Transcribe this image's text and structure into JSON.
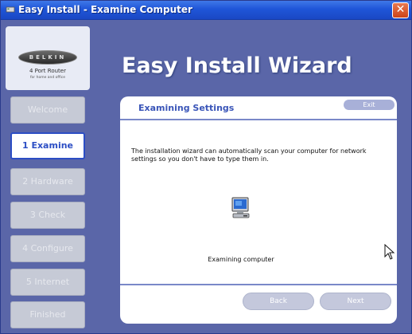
{
  "window": {
    "title": "Easy Install - Examine Computer",
    "close_glyph": "✕"
  },
  "logo": {
    "brand": "BELKIN",
    "product": "4 Port Router",
    "tagline": "for home and office"
  },
  "steps": [
    {
      "label": "Welcome",
      "active": false
    },
    {
      "label": "1 Examine",
      "active": true
    },
    {
      "label": "2 Hardware",
      "active": false
    },
    {
      "label": "3 Check",
      "active": false
    },
    {
      "label": "4 Configure",
      "active": false
    },
    {
      "label": "5 Internet",
      "active": false
    },
    {
      "label": "Finished",
      "active": false
    }
  ],
  "heading": "Easy Install Wizard",
  "panel": {
    "title": "Examining Settings",
    "exit_label": "Exit",
    "body": "The installation wizard can automatically scan your computer for network settings so you don't have to type them in.",
    "status": "Examining computer",
    "back_label": "Back",
    "next_label": "Next"
  },
  "colors": {
    "background": "#5a66a8",
    "accent": "#2c4ec4",
    "titlebar": "#1f55d8"
  },
  "icons": {
    "title": "app-icon",
    "close": "close-icon",
    "computer": "computer-icon",
    "cursor": "mouse-pointer-icon"
  }
}
